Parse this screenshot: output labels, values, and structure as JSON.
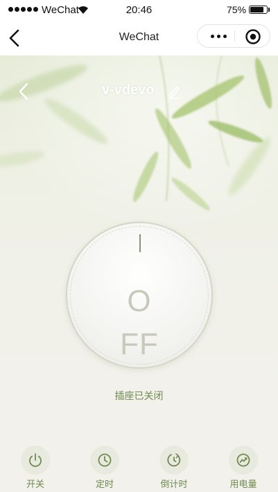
{
  "status_bar": {
    "carrier": "WeChat",
    "time": "20:46",
    "battery": "75%",
    "battery_level": 0.75
  },
  "nav_bar": {
    "title": "WeChat"
  },
  "device": {
    "name": "v-vdevo"
  },
  "power_dial": {
    "state_text": "OFF",
    "line1": "O",
    "line2": "FF"
  },
  "status": {
    "text": "插座已关闭"
  },
  "toolbar": {
    "items": [
      {
        "label": "开关",
        "icon": "power-icon"
      },
      {
        "label": "定时",
        "icon": "clock-icon"
      },
      {
        "label": "倒计时",
        "icon": "countdown-icon"
      },
      {
        "label": "用电量",
        "icon": "power-usage-icon"
      }
    ]
  },
  "colors": {
    "accent": "#6f8a4e",
    "dial_text": "#c9c9bb",
    "tool_circle": "#e9eadf"
  }
}
